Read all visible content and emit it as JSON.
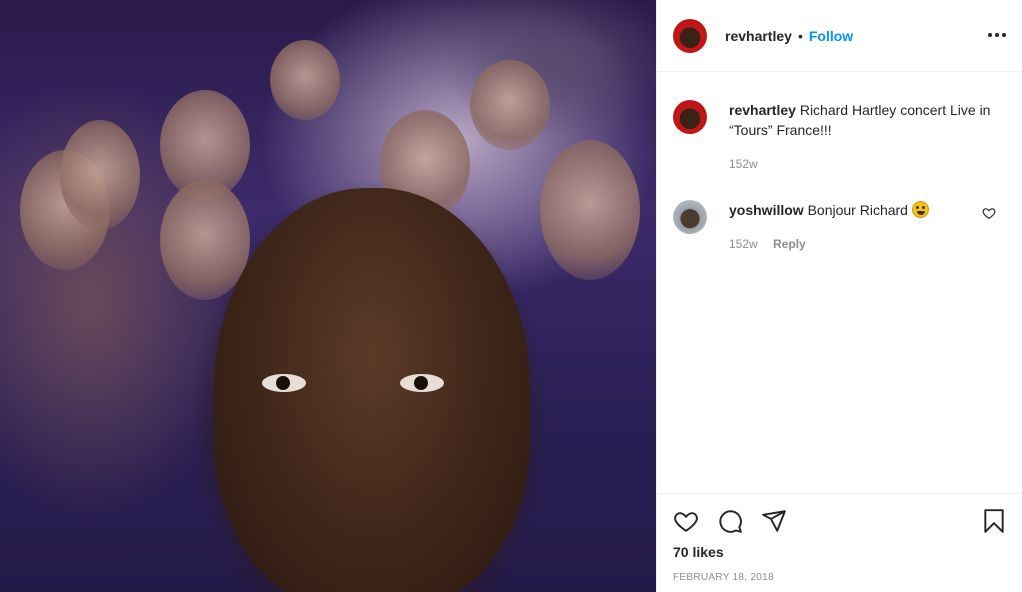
{
  "post": {
    "username": "revhartley",
    "follow_label": "Follow",
    "separator": "•"
  },
  "comments": [
    {
      "username": "revhartley",
      "text": "Richard Hartley concert Live in “Tours” France!!!",
      "age": "152w"
    },
    {
      "username": "yoshwillow",
      "text": "Bonjour Richard",
      "emoji": "grinning-face-emoji",
      "age": "152w",
      "reply_label": "Reply"
    }
  ],
  "footer": {
    "likes": "70 likes",
    "date": "FEBRUARY 18, 2018"
  },
  "icons": {
    "like": "heart-icon",
    "comment": "comment-icon",
    "share": "share-icon",
    "save": "bookmark-icon",
    "more": "more-options-icon",
    "comment_like": "heart-icon"
  },
  "colors": {
    "follow": "#0095f6",
    "meta": "#8e8e8e",
    "text": "#262626"
  }
}
